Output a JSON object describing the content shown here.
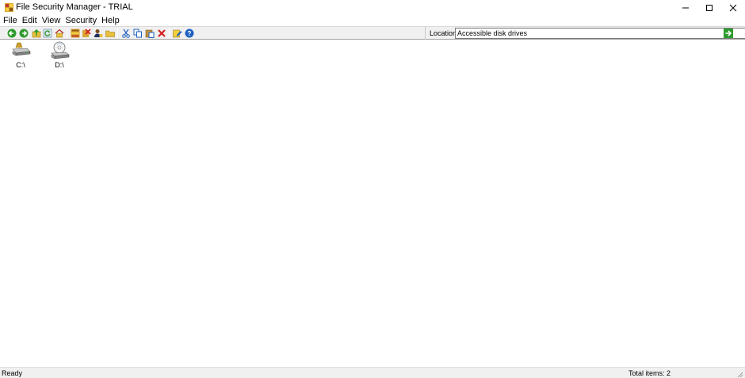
{
  "window": {
    "title": "File Security Manager - TRIAL",
    "minimize_glyph": "–",
    "maximize_glyph": "☐",
    "close_glyph": "✕"
  },
  "menu": {
    "items": [
      "File",
      "Edit",
      "View",
      "Security",
      "Help"
    ]
  },
  "toolbar": {
    "icons": [
      "back-icon",
      "forward-icon",
      "up-icon",
      "refresh-icon",
      "home-icon",
      "properties-icon",
      "delete-rights-icon",
      "user-icon",
      "folder-icon",
      "cut-icon",
      "copy-icon",
      "paste-icon",
      "delete-icon",
      "edit-icon",
      "help-icon"
    ],
    "accent_green": "#2e9a2e",
    "accent_red": "#d42020",
    "accent_blue": "#2060c0"
  },
  "location": {
    "label": "Location:",
    "value": "Accessible disk drives"
  },
  "drives": [
    {
      "label": "C:\\",
      "icon": "hard-drive-icon"
    },
    {
      "label": "D:\\",
      "icon": "cd-drive-icon"
    }
  ],
  "status": {
    "left": "Ready",
    "right": "Total items: 2"
  }
}
